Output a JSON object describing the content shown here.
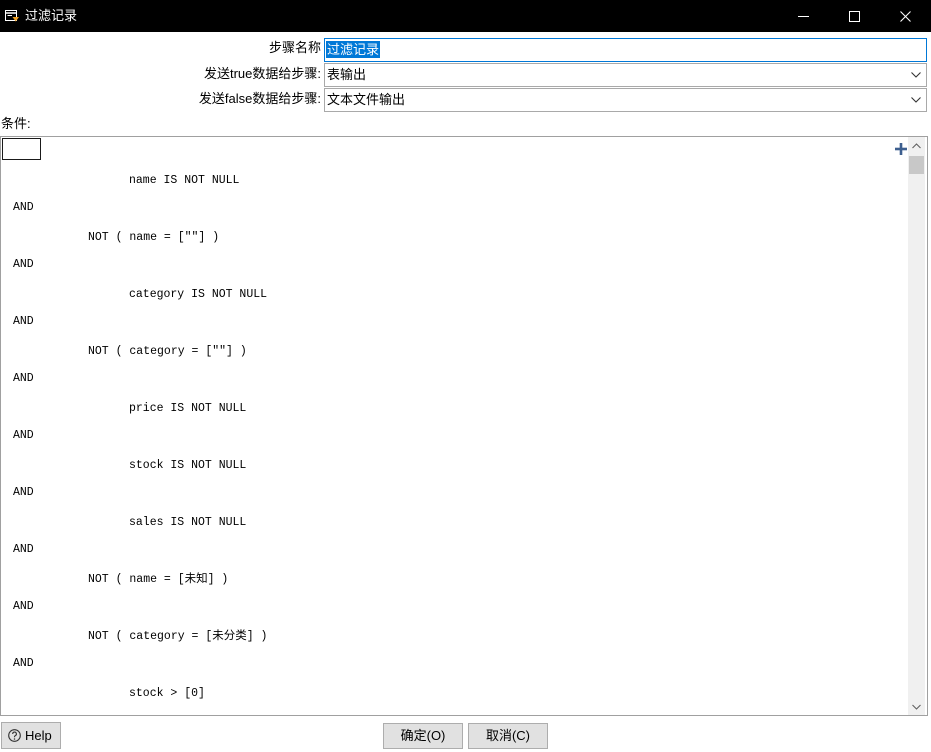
{
  "window": {
    "title": "过滤记录",
    "app_icon": "filter-rows-icon",
    "minimize_icon": "minimize-icon",
    "maximize_icon": "maximize-icon",
    "close_icon": "close-icon"
  },
  "form": {
    "step_name": {
      "label": "步骤名称",
      "value": "过滤记录"
    },
    "send_true_to": {
      "label": "发送true数据给步骤:",
      "value": "表输出",
      "icon": "chevron-down-icon"
    },
    "send_false_to": {
      "label": "发送false数据给步骤:",
      "value": "文本文件输出",
      "icon": "chevron-down-icon"
    }
  },
  "condition": {
    "label": "条件:",
    "add_icon": "plus-icon",
    "scroll_up_icon": "chevron-up-icon",
    "scroll_down_icon": "chevron-down-icon",
    "clauses": [
      {
        "text": "name IS NOT NULL"
      },
      {
        "operator": "AND",
        "text": "NOT ( name = [\"\"] )",
        "negated": true
      },
      {
        "operator": "AND",
        "text": "category IS NOT NULL"
      },
      {
        "operator": "AND",
        "text": "NOT ( category = [\"\"] )",
        "negated": true
      },
      {
        "operator": "AND",
        "text": "price IS NOT NULL"
      },
      {
        "operator": "AND",
        "text": "stock IS NOT NULL"
      },
      {
        "operator": "AND",
        "text": "sales IS NOT NULL"
      },
      {
        "operator": "AND",
        "text": "NOT ( name = [未知] )",
        "negated": true
      },
      {
        "operator": "AND",
        "text": "NOT ( category = [未分类] )",
        "negated": true
      },
      {
        "operator": "AND",
        "text": "stock > [0]"
      }
    ]
  },
  "buttons": {
    "help": {
      "label": "Help",
      "icon": "help-icon"
    },
    "ok": {
      "label": "确定(O)"
    },
    "cancel": {
      "label": "取消(C)"
    }
  },
  "colors": {
    "titlebar": "#000000",
    "accent": "#0078d7",
    "add_icon": "#3d5f8f"
  }
}
